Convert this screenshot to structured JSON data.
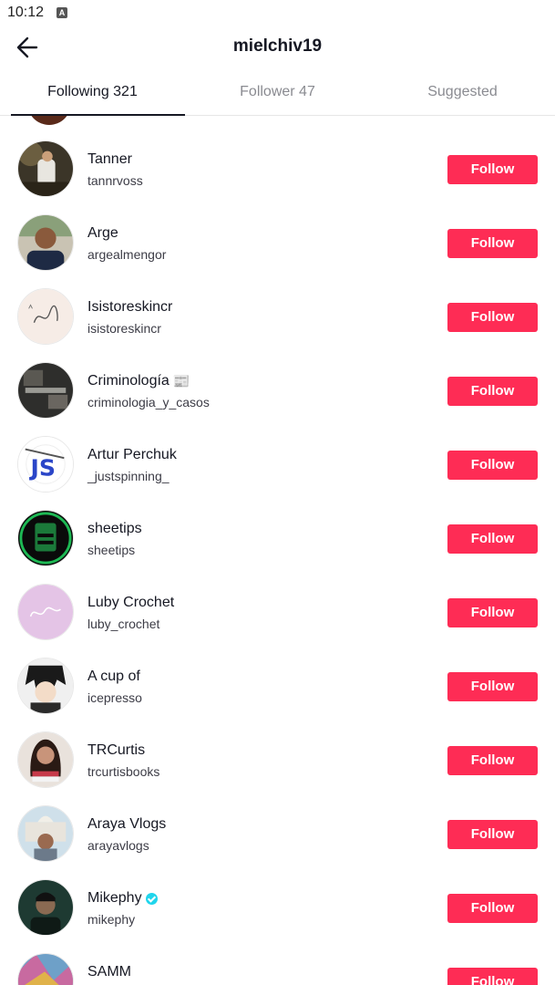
{
  "status_bar": {
    "time": "10:12",
    "app_icon": "A"
  },
  "header": {
    "title": "mielchiv19",
    "back_icon": "arrow-left-icon"
  },
  "tabs": [
    {
      "label": "Following 321",
      "active": true
    },
    {
      "label": "Follower 47",
      "active": false
    },
    {
      "label": "Suggested",
      "active": false
    }
  ],
  "colors": {
    "follow_button": "#fe2c55",
    "verified": "#20d5ec",
    "tab_active": "#161823",
    "tab_inactive": "#8a8b91"
  },
  "users": [
    {
      "name": "Tanner",
      "handle": "tannrvoss",
      "button": "Follow"
    },
    {
      "name": "Arge",
      "handle": "argealmengor",
      "button": "Follow"
    },
    {
      "name": "Isistoreskincr",
      "handle": "isistoreskincr",
      "button": "Follow"
    },
    {
      "name": "Criminología",
      "name_suffix": "📰",
      "handle": "criminologia_y_casos",
      "button": "Follow"
    },
    {
      "name": "Artur Perchuk",
      "handle": "_justspinning_",
      "button": "Follow"
    },
    {
      "name": "sheetips",
      "handle": "sheetips",
      "button": "Follow"
    },
    {
      "name": "Luby Crochet",
      "handle": "luby_crochet",
      "button": "Follow"
    },
    {
      "name": "A cup of",
      "handle": "icepresso",
      "button": "Follow"
    },
    {
      "name": "TRCurtis",
      "handle": "trcurtisbooks",
      "button": "Follow"
    },
    {
      "name": "Araya Vlogs",
      "handle": "arayavlogs",
      "button": "Follow"
    },
    {
      "name": "Mikephy",
      "verified": true,
      "handle": "mikephy",
      "button": "Follow"
    },
    {
      "name": "SAMM",
      "handle": "",
      "button": "Follow"
    }
  ]
}
